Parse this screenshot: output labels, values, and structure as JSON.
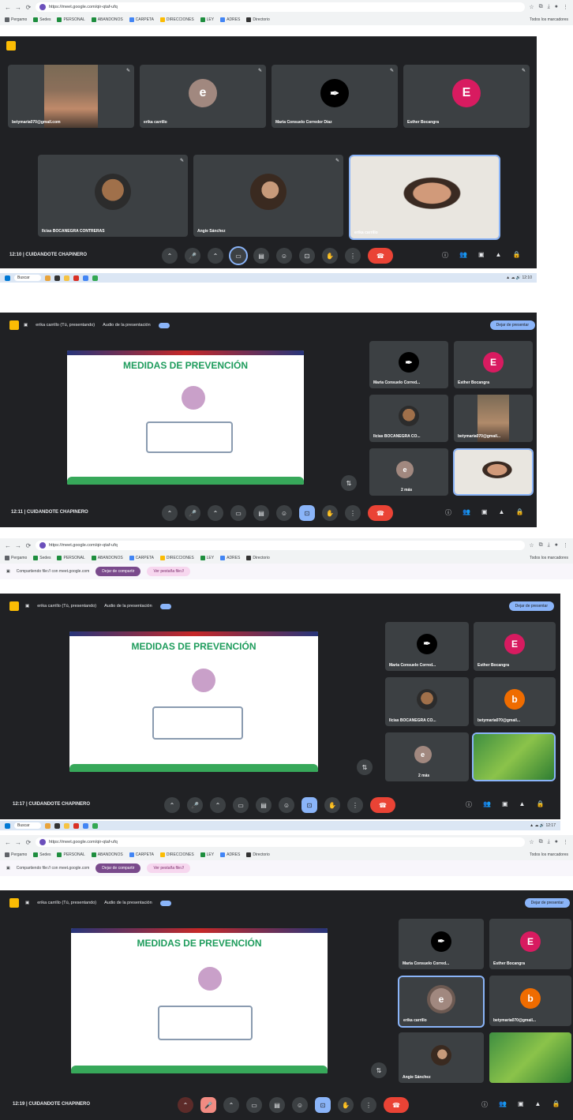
{
  "browser": {
    "url": "https://meet.google.com/qir-qtaf-ufq",
    "bookmarks": [
      "Pergamo",
      "Sedes",
      "PERSONAL",
      "ABANDONOS",
      "CARPETA",
      "DIRECCIONES",
      "LEY",
      "ADRES",
      "Directorio"
    ],
    "all_bookmarks": "Todos los marcadores",
    "share_notice": "Compartiendo file:// con meet.google.com",
    "stop_sharing": "Dejar de compartir",
    "view_tab": "Ver pestaña file://"
  },
  "meeting": {
    "name": "CUIDANDOTE CHAPINERO",
    "presenting_label": "erika carrillo (Tú, presentando)",
    "audio_label": "Audio de la presentación",
    "stop_presenting": "Dejar de presentar",
    "slide_title": "MEDIDAS DE PREVENCIÓN",
    "more_count": "2 más"
  },
  "screens": [
    {
      "time": "12:10",
      "participants": [
        {
          "name": "betymaria070@gmail.com",
          "type": "photo"
        },
        {
          "name": "erika carrillo",
          "type": "letter",
          "letter": "e",
          "color": "#a1887f"
        },
        {
          "name": "Maria Consuelo Corredor Díaz",
          "type": "icon"
        },
        {
          "name": "Esther Bocangra",
          "type": "letter",
          "letter": "E",
          "color": "#d81b60"
        },
        {
          "name": "Ilcias BOCANEGRA CONTRERAS",
          "type": "avatar"
        },
        {
          "name": "Angie Sánchez",
          "type": "avatar"
        },
        {
          "name": "erika carrillo",
          "type": "photo"
        }
      ]
    },
    {
      "time": "12:11",
      "participants": [
        {
          "name": "Maria Consuelo Corred...",
          "type": "icon"
        },
        {
          "name": "Esther Bocangra",
          "type": "letter",
          "letter": "E",
          "color": "#d81b60"
        },
        {
          "name": "Ilcias BOCANEGRA CO...",
          "type": "avatar"
        },
        {
          "name": "betymaria070@gmail...",
          "type": "photo"
        }
      ]
    },
    {
      "time": "12:17",
      "participants": [
        {
          "name": "Maria Consuelo Corred...",
          "type": "icon"
        },
        {
          "name": "Esther Bocangra",
          "type": "letter",
          "letter": "E",
          "color": "#d81b60"
        },
        {
          "name": "Ilcias BOCANEGRA CO...",
          "type": "avatar"
        },
        {
          "name": "betymaria070@gmail...",
          "type": "letter",
          "letter": "b",
          "color": "#ef6c00"
        }
      ]
    },
    {
      "time": "12:19",
      "participants": [
        {
          "name": "Maria Consuelo Corred...",
          "type": "icon"
        },
        {
          "name": "Esther Bocangra",
          "type": "letter",
          "letter": "E",
          "color": "#d81b60"
        },
        {
          "name": "erika carrillo",
          "type": "letter",
          "letter": "e",
          "color": "#a1887f"
        },
        {
          "name": "betymaria070@gmail...",
          "type": "letter",
          "letter": "b",
          "color": "#ef6c00"
        },
        {
          "name": "Angie Sánchez",
          "type": "avatar"
        }
      ]
    }
  ],
  "taskbar": {
    "search": "Buscar"
  },
  "colors": {
    "meet_bg": "#202124",
    "tile": "#3c4043",
    "accent": "#8ab4f8",
    "hangup": "#ea4335"
  }
}
